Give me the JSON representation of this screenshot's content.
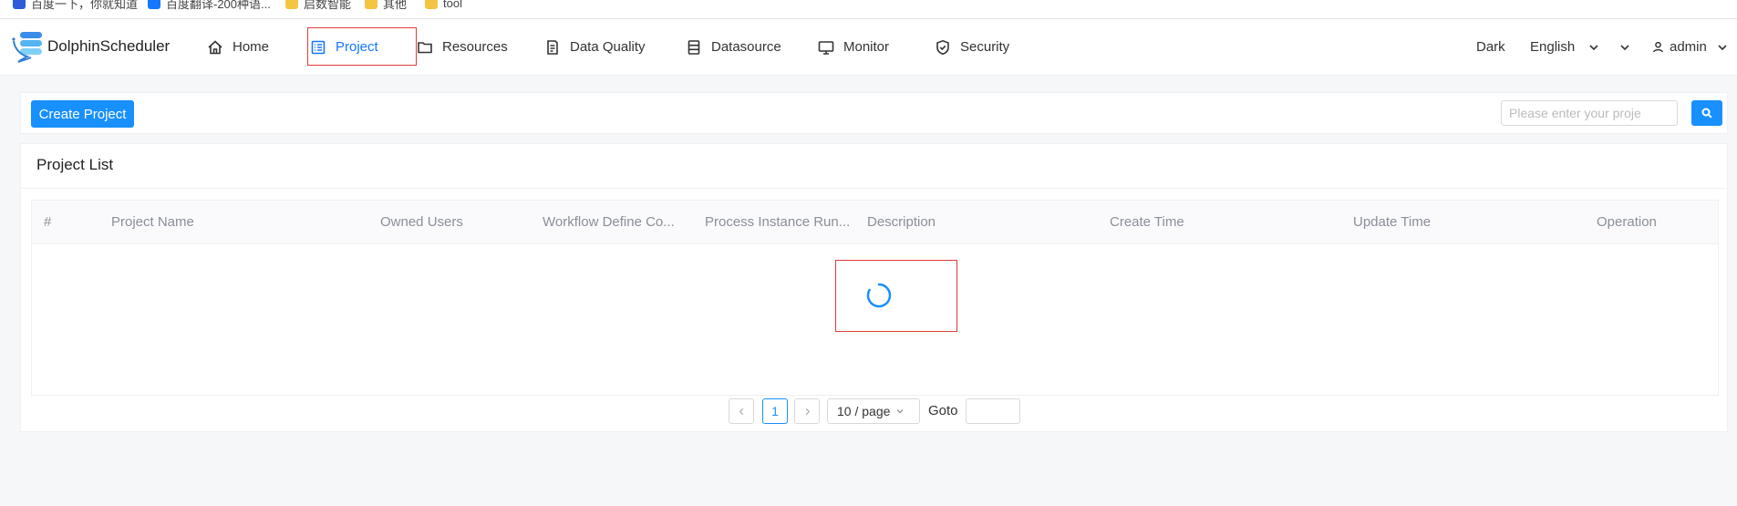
{
  "bookmarks": [
    {
      "label": "百度一下，你就知道",
      "icon": "paw-icon"
    },
    {
      "label": "百度翻译-200种语...",
      "icon": "translate-icon"
    },
    {
      "label": "启数智能",
      "icon": "folder-icon"
    },
    {
      "label": "其他",
      "icon": "folder-icon"
    },
    {
      "label": "tool",
      "icon": "folder-icon"
    }
  ],
  "header": {
    "logo_text": "DolphinScheduler",
    "nav": [
      {
        "label": "Home",
        "icon": "home-icon"
      },
      {
        "label": "Project",
        "icon": "project-icon",
        "active": true
      },
      {
        "label": "Resources",
        "icon": "folder-icon"
      },
      {
        "label": "Data Quality",
        "icon": "data-quality-icon"
      },
      {
        "label": "Datasource",
        "icon": "datasource-icon"
      },
      {
        "label": "Monitor",
        "icon": "monitor-icon"
      },
      {
        "label": "Security",
        "icon": "shield-icon"
      }
    ],
    "theme_label": "Dark",
    "language_label": "English",
    "user_label": "admin"
  },
  "toolbar": {
    "create_label": "Create Project",
    "search_placeholder": "Please enter your proje"
  },
  "project_list": {
    "title": "Project List",
    "columns": [
      "#",
      "Project Name",
      "Owned Users",
      "Workflow Define Co...",
      "Process Instance Run...",
      "Description",
      "Create Time",
      "Update Time",
      "Operation"
    ],
    "rows": [],
    "loading": true
  },
  "pagination": {
    "current_page": "1",
    "page_size_label": "10 / page",
    "goto_label": "Goto"
  },
  "colors": {
    "accent": "#1890ff",
    "highlight_box": "#e23b3b"
  }
}
